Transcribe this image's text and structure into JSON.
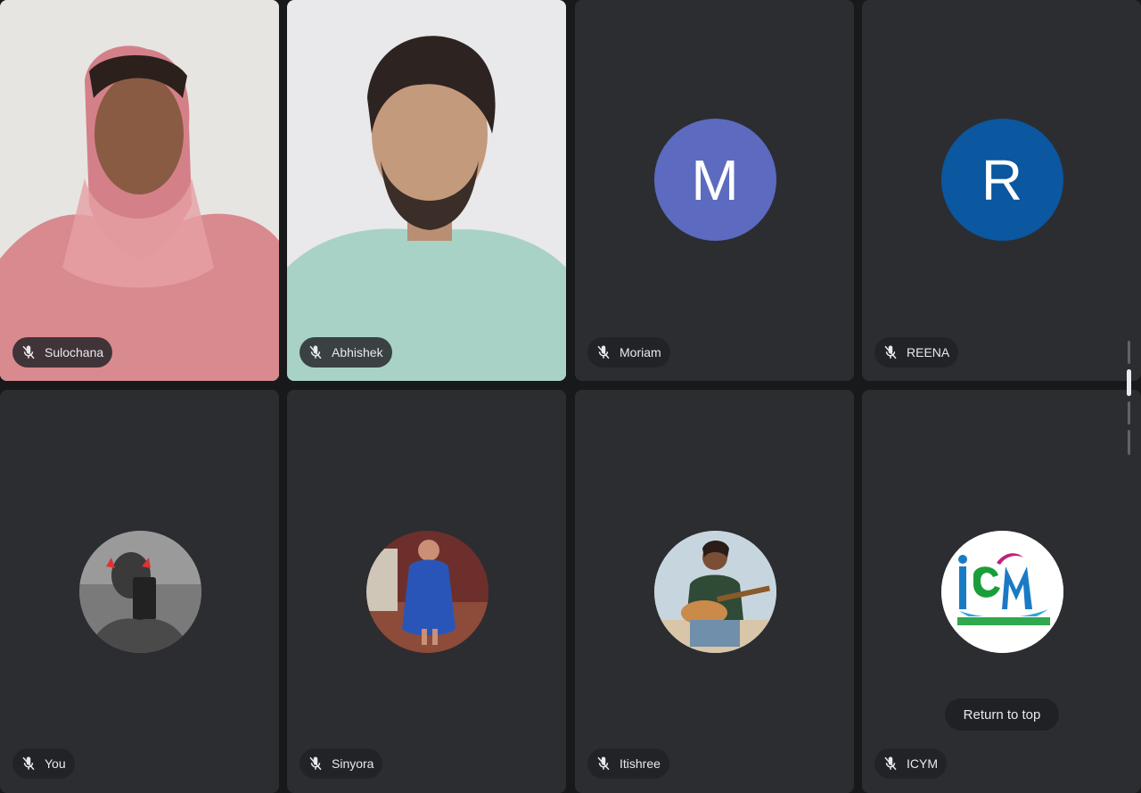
{
  "participants": [
    {
      "name": "Sulochana",
      "type": "video",
      "muted": true
    },
    {
      "name": "Abhishek",
      "type": "video",
      "muted": true
    },
    {
      "name": "Moriam",
      "type": "initial",
      "initial": "M",
      "avatar_color": "#5c6bc0",
      "muted": true
    },
    {
      "name": "REENA",
      "type": "initial",
      "initial": "R",
      "avatar_color": "#0b57a0",
      "muted": true
    },
    {
      "name": "You",
      "type": "photo",
      "muted": true
    },
    {
      "name": "Sinyora",
      "type": "photo",
      "muted": true
    },
    {
      "name": "Itishree",
      "type": "photo",
      "muted": true
    },
    {
      "name": "ICYM",
      "type": "photo",
      "muted": true
    }
  ],
  "return_to_top": "Return to top",
  "colors": {
    "tile_bg": "#2c2d31",
    "page_bg": "#18191b",
    "pill_bg": "#202124",
    "pill_text": "#e8eaed"
  },
  "icons": {
    "mic_off": "mic-off-icon"
  }
}
